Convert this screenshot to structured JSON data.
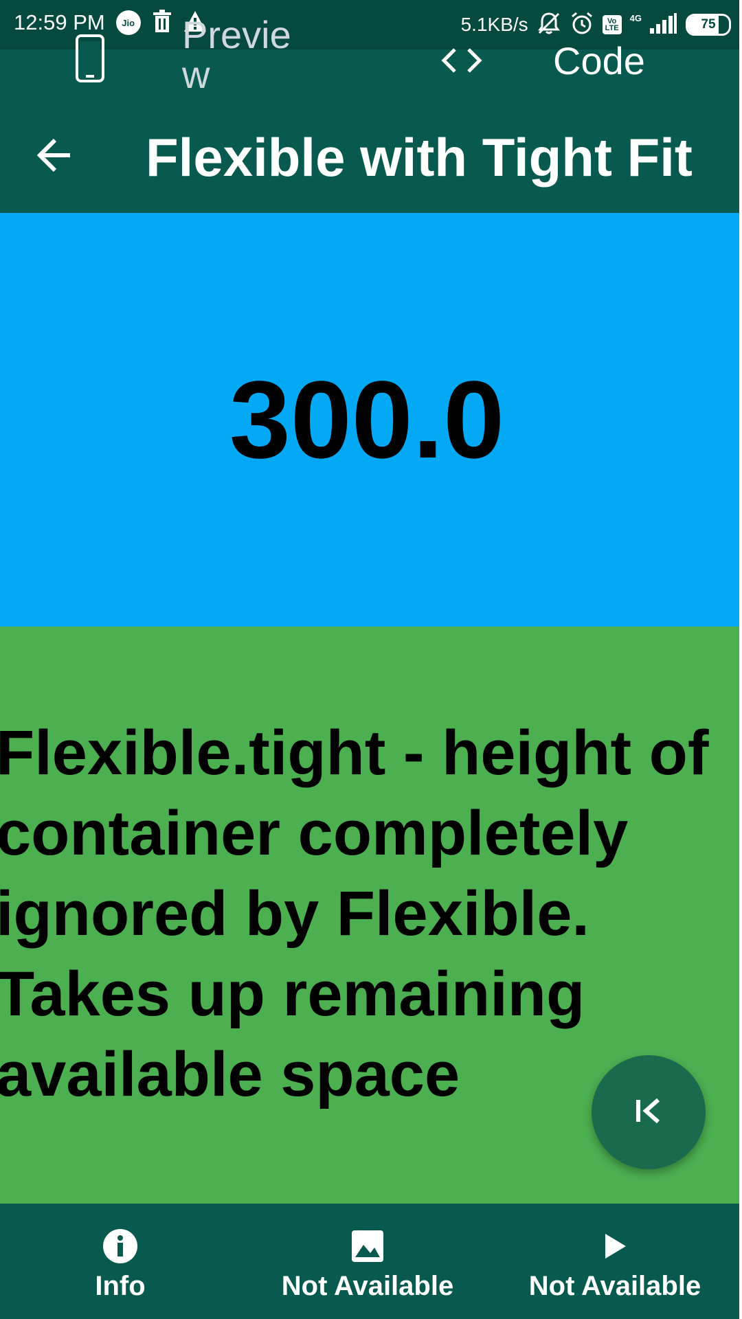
{
  "status_bar": {
    "time": "12:59 PM",
    "carrier_badge": "Jio",
    "net_speed": "5.1KB/s",
    "volte_label": "Vo LTE",
    "network_type": "4G",
    "battery_level": "75",
    "battery_fraction": 0.75
  },
  "tabs": {
    "preview_label": "Preview",
    "code_label": "Code"
  },
  "app_bar": {
    "title": "Flexible with Tight Fit"
  },
  "content": {
    "blue_value": "300.0",
    "green_text": "Flexible.tight - height of container completely ignored by Flexible. Takes up remaining available space"
  },
  "bottom_nav": {
    "items": [
      {
        "label": "Info",
        "icon": "info-icon"
      },
      {
        "label": "Not Available",
        "icon": "image-icon"
      },
      {
        "label": "Not Available",
        "icon": "play-icon"
      }
    ]
  },
  "colors": {
    "status_bar": "#06493F",
    "primary": "#085A4F",
    "blue_box": "#03A9F4",
    "green_box": "#4CAF50",
    "fab": "#1A6B4E"
  }
}
